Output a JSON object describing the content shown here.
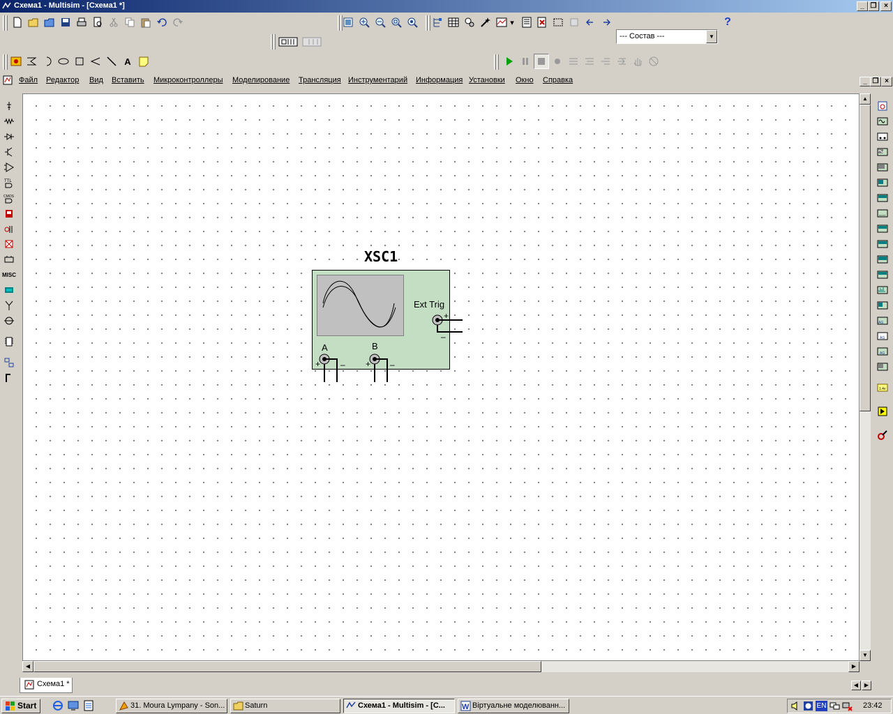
{
  "window": {
    "title": "Схема1 - Multisim - [Схема1 *]"
  },
  "toolbar": {
    "component_select": "--- Состав ---",
    "help_glyph": "?"
  },
  "menu": {
    "items": [
      "Файл",
      "Редактор",
      "Вид",
      "Вставить",
      "Микроконтроллеры",
      "Моделирование",
      "Трансляция",
      "Инструментарий",
      "Информация",
      "Установки",
      "Окно",
      "Справка"
    ]
  },
  "palette_left": {
    "misc_label": "MISC"
  },
  "instrument": {
    "name": "XSC1",
    "ext_trig_label": "Ext Trig",
    "channel_a": "A",
    "channel_b": "B",
    "plus": "+",
    "minus": "–"
  },
  "document_tab": {
    "label": "Схема1 *"
  },
  "taskbar": {
    "start_label": "Start",
    "tasks": [
      {
        "label": "31. Moura Lympany - Son..."
      },
      {
        "label": "Saturn"
      },
      {
        "label": "Схема1 - Multisim - [С..."
      },
      {
        "label": "Віртуальне моделюванн..."
      }
    ],
    "language": "EN",
    "clock": "23:42"
  },
  "colors": {
    "titlebar_start": "#0a246a",
    "titlebar_end": "#a6caf0",
    "instrument_body": "#c4dec4",
    "instrument_screen": "#c0c0c0"
  }
}
